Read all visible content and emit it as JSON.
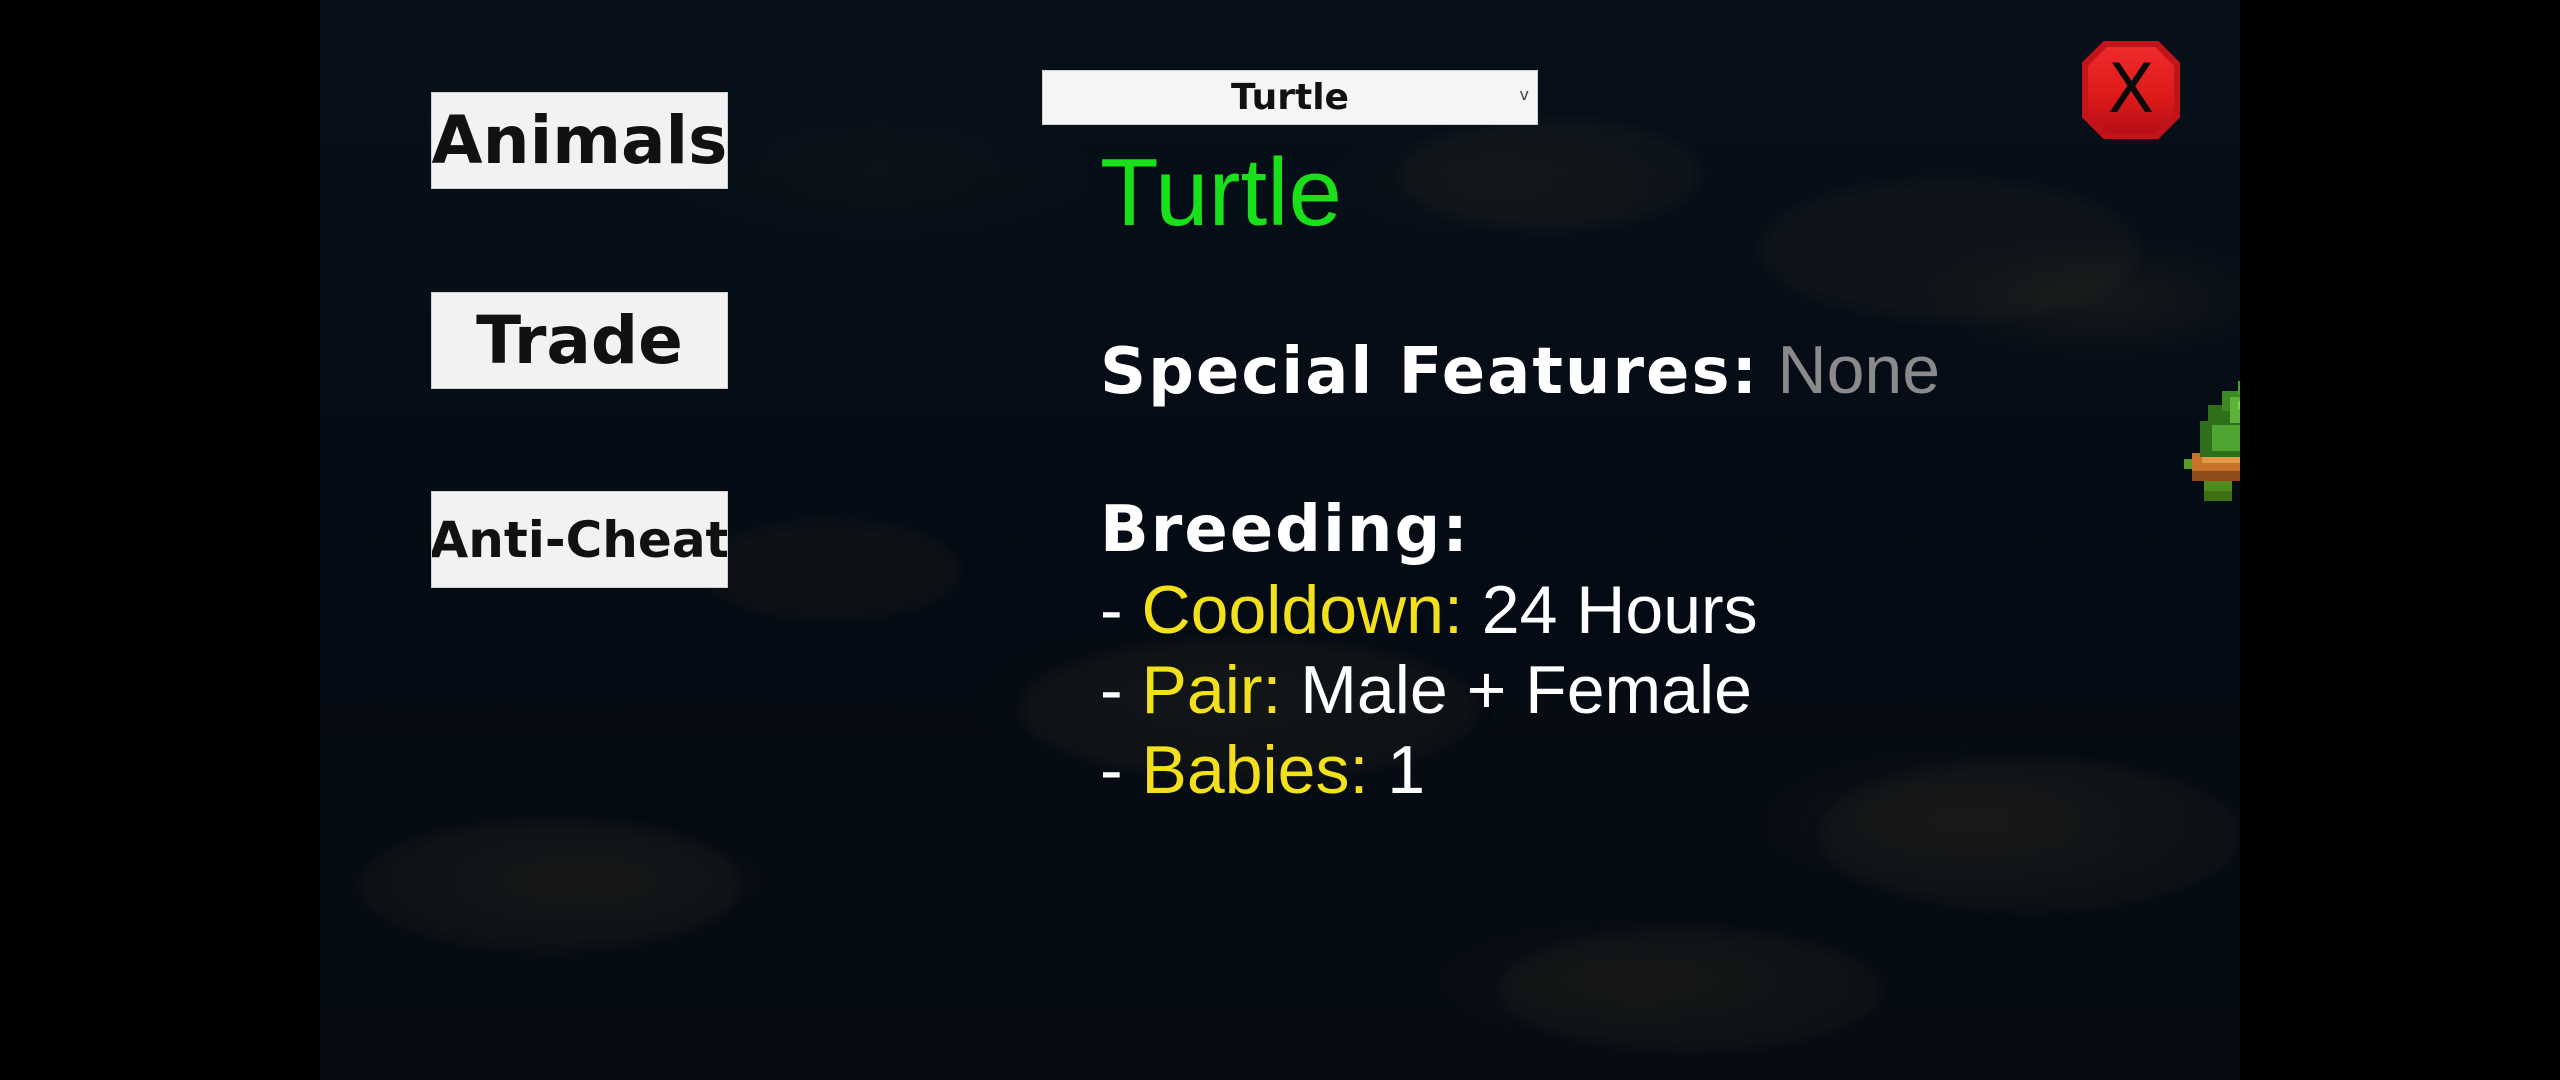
{
  "nav": {
    "animals_label": "Animals",
    "trade_label": "Trade",
    "anticheat_label": "Anti-Cheat"
  },
  "select": {
    "value": "Turtle",
    "arrow": "v"
  },
  "close": {
    "label": "X",
    "color": "#e01c1c"
  },
  "animal": {
    "name": "Turtle",
    "name_color": "#19e01a",
    "special_label": "Special Features:",
    "special_value": "None",
    "breeding_label": "Breeding:",
    "bullet": "- ",
    "cooldown_key": "Cooldown:",
    "cooldown_value": "24 Hours",
    "pair_key": "Pair:",
    "pair_value": "Male + Female",
    "babies_key": "Babies:",
    "babies_value": "1",
    "key_color": "#f2e01c",
    "sprite": "turtle-sprite"
  }
}
